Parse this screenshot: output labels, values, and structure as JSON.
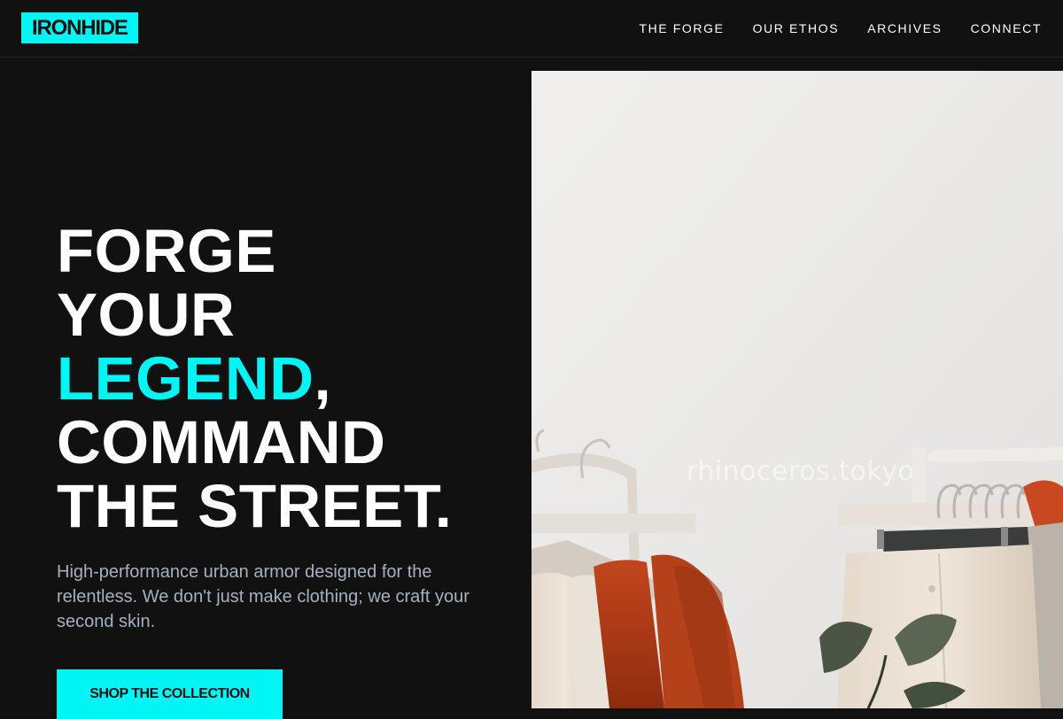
{
  "brand": {
    "logo_text": "IRONHIDE"
  },
  "nav": {
    "items": [
      {
        "label": "THE FORGE"
      },
      {
        "label": "OUR ETHOS"
      },
      {
        "label": "ARCHIVES"
      },
      {
        "label": "CONNECT"
      }
    ]
  },
  "hero": {
    "title_lines": [
      "FORGE",
      "YOUR",
      "LEGEND",
      ",",
      "COMMAND",
      "THE STREET."
    ],
    "description": "High-performance urban armor designed for the relentless. We don't just make clothing; we craft your second skin.",
    "cta_label": "SHOP THE COLLECTION",
    "image": {
      "watermark": "rhinoceros.tokyo"
    }
  },
  "colors": {
    "background": "#111111",
    "accent": "#00f5f5",
    "text": "#ffffff",
    "muted_text": "#a7b0c0"
  }
}
